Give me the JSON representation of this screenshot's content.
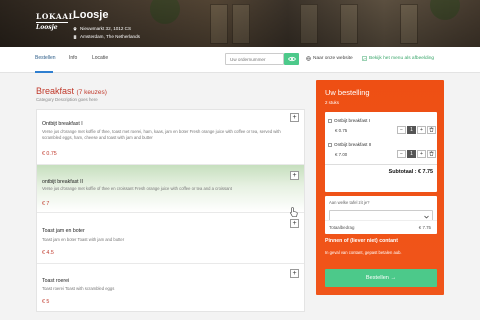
{
  "header": {
    "logo_line1": "LOKAAL",
    "logo_line2": "Loosje",
    "restaurant_name": "Loosje",
    "address": "Nieuwmarkt 32, 1012 CS",
    "city": "Amsterdam, The Netherlands"
  },
  "nav": {
    "tabs": [
      {
        "label": "Bestellen",
        "active": true
      },
      {
        "label": "Info",
        "active": false
      },
      {
        "label": "Locatie",
        "active": false
      }
    ],
    "order_placeholder": "Uw ordernummer",
    "website_link": "Naar onze website",
    "menu_link": "Bekijk het menu als afbeelding"
  },
  "category": {
    "title": "Breakfast",
    "count": "(7 keuzes)",
    "description": "Category Description goes here"
  },
  "items": [
    {
      "name": "Ontbijt breakfast I",
      "desc": "Verse jus d'orange met koffie of thee, toast met roerei, ham, kaas, jam en boter Fresh orange juice with coffee or tea, served with scrambled eggs, ham, cheese and toast with jam and butter",
      "price": "€ 0.75",
      "add": "+"
    },
    {
      "name": "ontbijt breakfast II",
      "desc": "Verse jus d'orange met koffie of thee en croissant Fresh orange juice with coffee or tea and a croissant",
      "price": "€ 7",
      "add": "+"
    },
    {
      "name": "Toast jam en boter",
      "desc": "Toast jam en boter Toast with jam and butter",
      "price": "€ 4.5",
      "add": "+"
    },
    {
      "name": "Toast roerei",
      "desc": "Toast roerei Toast with scrambled eggs",
      "price": "€ 5",
      "add": "+"
    }
  ],
  "order": {
    "title": "Uw bestelling",
    "subtitle": "2 stuks",
    "lines": [
      {
        "name": "Ontbijt breakfast I",
        "price": "€ 0.75",
        "qty": "1"
      },
      {
        "name": "Ontbijt breakfast II",
        "price": "€ 7.00",
        "qty": "1"
      }
    ],
    "qty_minus": "−",
    "qty_plus": "+",
    "subtotal": "Subtotaal : € 7.75",
    "table_question": "Aan welke tafel zit je?",
    "total_label": "Totaalbedrag",
    "total_value": "€ 7.75",
    "pay_title": "Pinnen of (liever niet) contant",
    "pay_sub": "In geval van contant, gepast betalen aub.",
    "checkout_label": "Bestellen →"
  },
  "colors": {
    "accent_orange": "#ee4f14",
    "accent_green": "#4cc98a",
    "price_red": "#c0392b",
    "tab_blue": "#2f7fd0"
  }
}
